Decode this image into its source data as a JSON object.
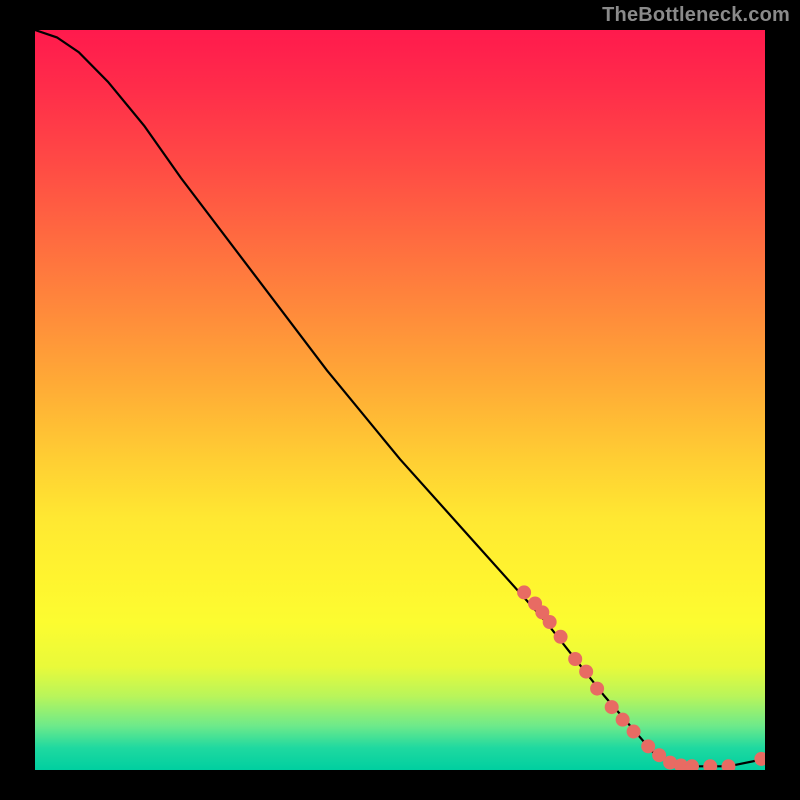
{
  "attribution": "TheBottleneck.com",
  "chart_data": {
    "type": "line",
    "title": "",
    "xlabel": "",
    "ylabel": "",
    "xlim": [
      0,
      100
    ],
    "ylim": [
      0,
      100
    ],
    "grid": false,
    "curve_x": [
      0,
      3,
      6,
      10,
      15,
      20,
      30,
      40,
      50,
      60,
      70,
      78,
      85,
      90,
      95,
      100
    ],
    "curve_y": [
      100,
      99,
      97,
      93,
      87,
      80,
      67,
      54,
      42,
      31,
      20,
      10,
      2,
      0.5,
      0.5,
      1.5
    ],
    "markers_x": [
      67,
      68.5,
      69.5,
      70.5,
      72,
      74,
      75.5,
      77,
      79,
      80.5,
      82,
      84,
      85.5,
      87,
      88.5,
      90,
      92.5,
      95,
      99.5
    ],
    "markers_y": [
      24,
      22.5,
      21.3,
      20.0,
      18,
      15,
      13.3,
      11,
      8.5,
      6.8,
      5.2,
      3.2,
      2.0,
      1.0,
      0.6,
      0.5,
      0.5,
      0.5,
      1.5
    ],
    "marker_color": "#e86b63",
    "marker_radius": 7
  }
}
